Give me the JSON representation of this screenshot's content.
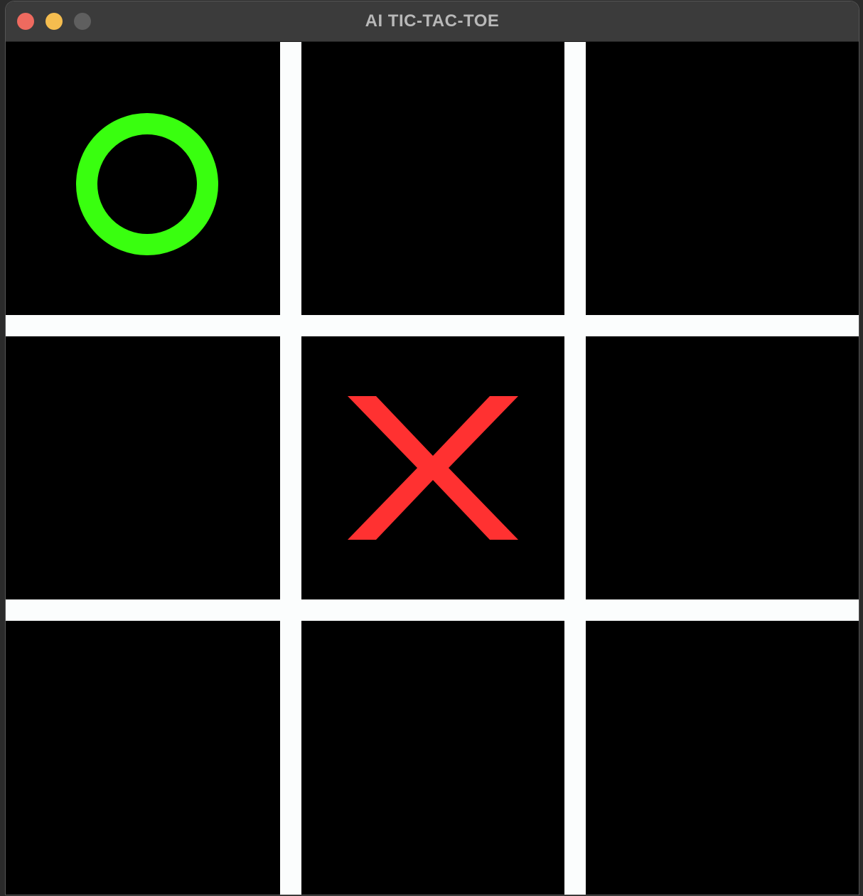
{
  "window": {
    "title": "AI TIC-TAC-TOE"
  },
  "board": {
    "cells": [
      [
        "O",
        "",
        ""
      ],
      [
        "",
        "X",
        ""
      ],
      [
        "",
        "",
        ""
      ]
    ]
  },
  "colors": {
    "o_mark": "#39ff0f",
    "x_mark": "#ff3131",
    "grid_lines": "#fbfdfd",
    "background": "#000000"
  },
  "icons": {
    "close": "close-icon",
    "minimize": "minimize-icon",
    "maximize": "maximize-icon",
    "o": "circle-mark-icon",
    "x": "cross-mark-icon"
  }
}
